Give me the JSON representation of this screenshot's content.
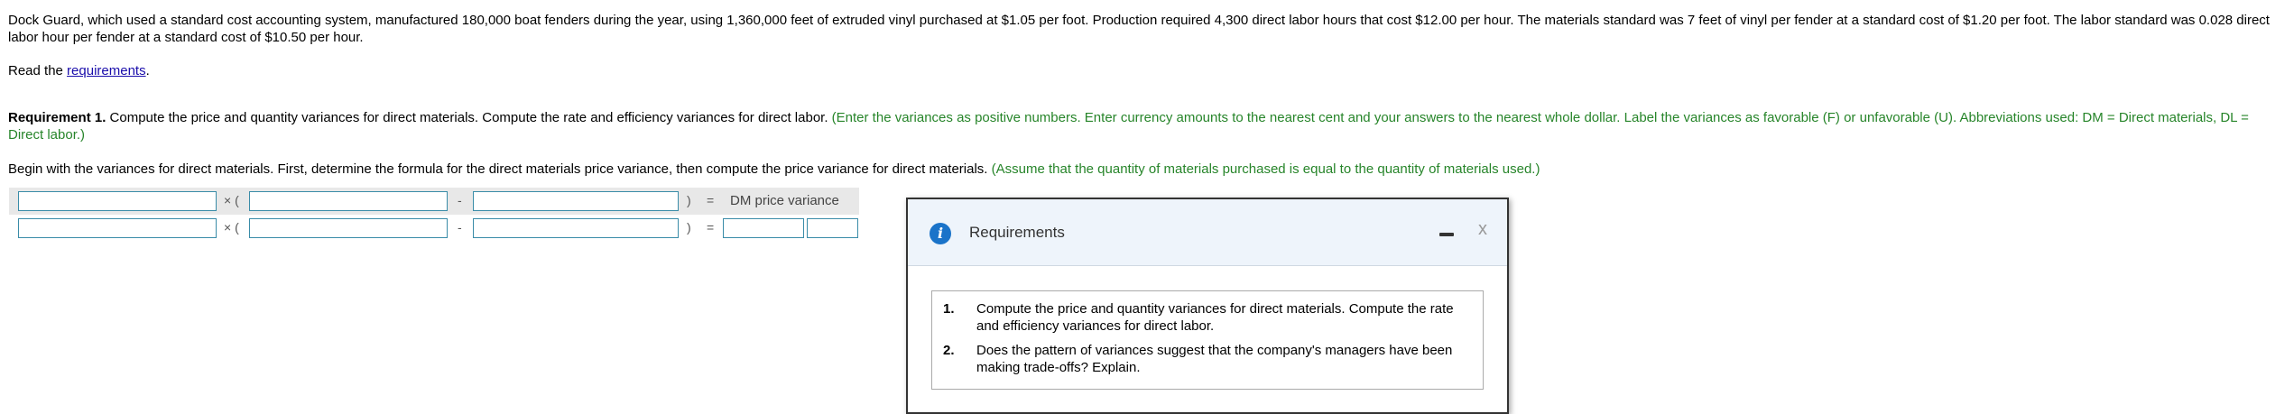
{
  "problem_text": "Dock Guard, which used a standard cost accounting system, manufactured 180,000 boat fenders during the year, using 1,360,000 feet of extruded vinyl purchased at $1.05 per foot. Production required 4,300 direct labor hours that cost $12.00 per hour. The materials standard was 7 feet of vinyl per fender at a standard cost of $1.20 per foot. The labor standard was 0.028 direct labor hour per fender at a standard cost of $10.50 per hour.",
  "read": {
    "prefix": "Read the ",
    "link": "requirements",
    "suffix": "."
  },
  "requirement1": {
    "label": "Requirement 1.",
    "text": " Compute the price and quantity variances for direct materials. Compute the rate and efficiency variances for direct labor. ",
    "note": "(Enter the variances as positive numbers. Enter currency amounts to the nearest cent and your answers to the nearest whole dollar. Label the variances as favorable (F) or unfavorable (U). Abbreviations used: DM = Direct materials, DL = Direct labor.)"
  },
  "begin": {
    "text": "Begin with the variances for direct materials. First, determine the formula for the direct materials price variance, then compute the price variance for direct materials. ",
    "note": "(Assume that the quantity of materials purchased is equal to the quantity of materials used.)"
  },
  "formula": {
    "times": "× (",
    "minus": "-",
    "close": ")",
    "equals": "=",
    "result_label": "DM price variance",
    "row1": {
      "input1": "",
      "input2": "",
      "input3": ""
    },
    "row2": {
      "input1": "",
      "input2": "",
      "input3": "",
      "amount": "",
      "fu": ""
    }
  },
  "dialog": {
    "title": "Requirements",
    "info_icon": "i",
    "close_icon": "x",
    "items": [
      {
        "num": "1.",
        "text": "Compute the price and quantity variances for direct materials. Compute the rate and efficiency variances for direct labor."
      },
      {
        "num": "2.",
        "text": "Does the pattern of variances suggest that the company's managers have been making trade-offs? Explain."
      }
    ]
  },
  "colors": {
    "note_green": "#27852a",
    "input_border": "#3a8ca8",
    "info_blue": "#1a73c9",
    "dialog_header": "#eef4fb"
  }
}
